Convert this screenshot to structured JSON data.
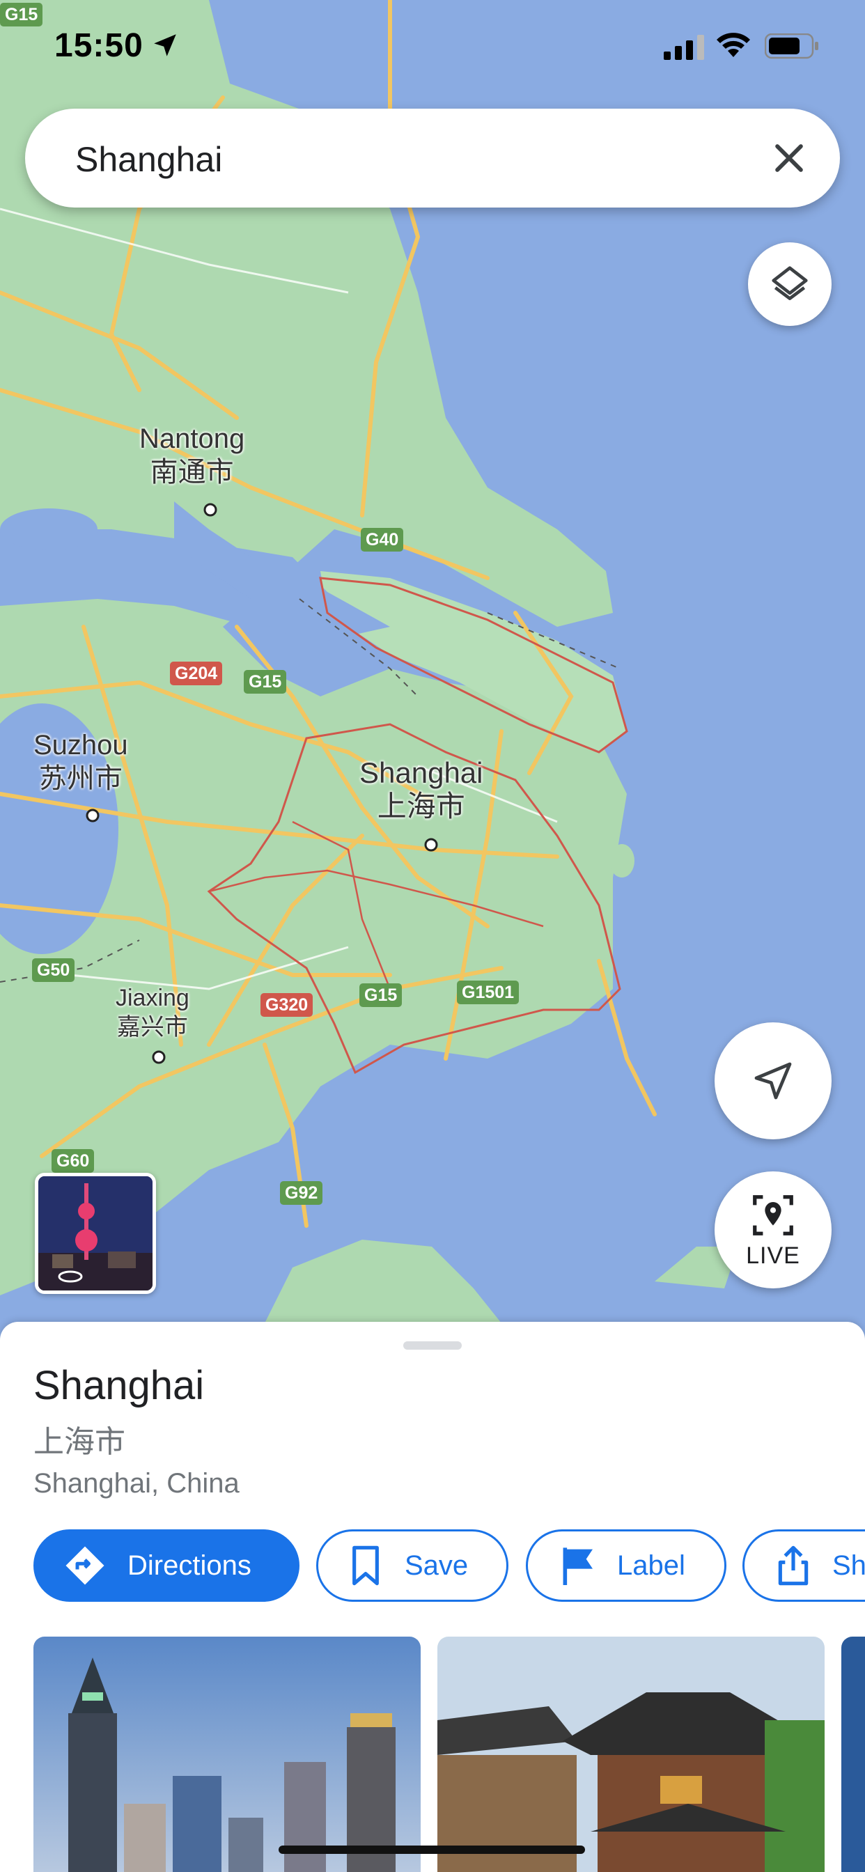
{
  "status_bar": {
    "time": "15:50"
  },
  "search": {
    "query": "Shanghai"
  },
  "map": {
    "cities": [
      {
        "en": "Nantong",
        "zh": "南通市"
      },
      {
        "en": "Suzhou",
        "zh": "苏州市"
      },
      {
        "en": "Shanghai",
        "zh": "上海市"
      },
      {
        "en": "Jiaxing",
        "zh": "嘉兴市"
      }
    ],
    "road_shields": [
      "G15",
      "G40",
      "G204",
      "G15",
      "G50",
      "G320",
      "G15",
      "G1501",
      "G60",
      "G92"
    ],
    "live_label": "LIVE"
  },
  "place": {
    "name": "Shanghai",
    "native_name": "上海市",
    "address": "Shanghai, China",
    "actions": [
      {
        "label": "Directions",
        "icon": "directions-icon"
      },
      {
        "label": "Save",
        "icon": "bookmark-icon"
      },
      {
        "label": "Label",
        "icon": "flag-icon"
      },
      {
        "label": "Sh",
        "icon": "share-icon"
      }
    ]
  },
  "colors": {
    "water": "#8aabe2",
    "land": "#aed9b0",
    "accent": "#1a73e8",
    "boundary": "#d0574b",
    "road": "#f2c661"
  }
}
